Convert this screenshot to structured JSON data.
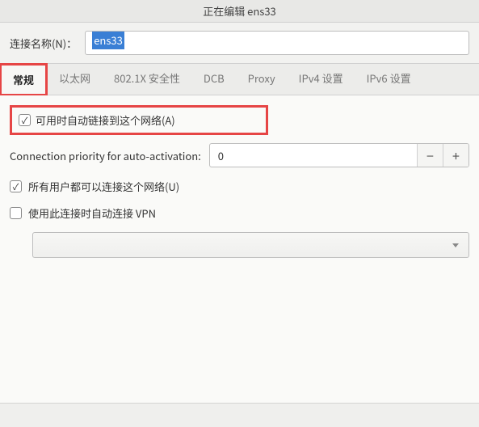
{
  "title": "正在编辑 ens33",
  "nameLabel": "连接名称(N)：",
  "nameValue": "ens33",
  "tabs": [
    {
      "label": "常规",
      "active": true
    },
    {
      "label": "以太网",
      "active": false
    },
    {
      "label": "802.1X 安全性",
      "active": false
    },
    {
      "label": "DCB",
      "active": false
    },
    {
      "label": "Proxy",
      "active": false
    },
    {
      "label": "IPv4 设置",
      "active": false
    },
    {
      "label": "IPv6 设置",
      "active": false
    }
  ],
  "general": {
    "autoConnectLabel": "可用时自动链接到这个网络(A)",
    "autoConnectChecked": true,
    "priorityLabel": "Connection priority for auto-activation:",
    "priorityValue": "0",
    "allUsersLabel": "所有用户都可以连接这个网络(U)",
    "allUsersChecked": true,
    "autoVpnLabel": "使用此连接时自动连接 VPN",
    "autoVpnChecked": false
  }
}
